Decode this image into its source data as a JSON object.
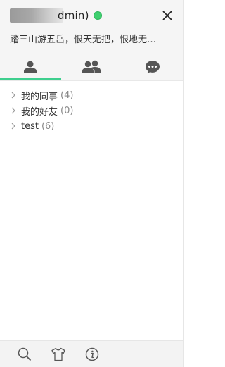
{
  "header": {
    "name_visible": "dmin)",
    "signature": "踏三山游五岳，恨天无把，恨地无…",
    "status_color": "#3ecf6e",
    "close_icon": "close-icon"
  },
  "tabs": [
    {
      "icon": "person-icon",
      "active": true
    },
    {
      "icon": "group-icon",
      "active": false
    },
    {
      "icon": "chat-icon",
      "active": false
    }
  ],
  "groups": [
    {
      "label": "我的同事",
      "count": "(4)"
    },
    {
      "label": "我的好友",
      "count": "(0)"
    },
    {
      "label": "test",
      "count": "(6)"
    }
  ],
  "footer": {
    "icons": [
      "search-icon",
      "shirt-icon",
      "info-icon"
    ]
  },
  "colors": {
    "accent": "#3ecf8e",
    "header_bg": "#f5f5f5"
  }
}
